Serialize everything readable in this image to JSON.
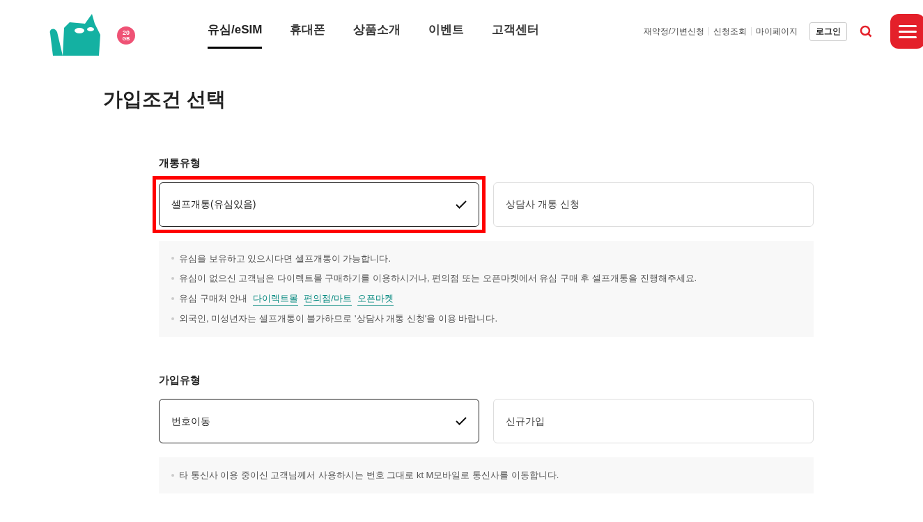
{
  "header": {
    "logo_badge": [
      "20",
      "GB"
    ],
    "nav": [
      {
        "label": "유심/eSIM",
        "selected": true
      },
      {
        "label": "휴대폰",
        "selected": false
      },
      {
        "label": "상품소개",
        "selected": false
      },
      {
        "label": "이벤트",
        "selected": false
      },
      {
        "label": "고객센터",
        "selected": false
      }
    ],
    "util_links": [
      "재약정/기변신청",
      "신청조회",
      "마이페이지"
    ],
    "login": "로그인"
  },
  "title": "가입조건 선택",
  "sections": [
    {
      "heading": "개통유형",
      "options": [
        {
          "label": "셀프개통(유심있음)",
          "selected": true,
          "highlighted": true
        },
        {
          "label": "상담사 개통 신청",
          "selected": false,
          "highlighted": false
        }
      ],
      "notes": [
        {
          "text": "유심을 보유하고 있으시다면 셀프개통이 가능합니다."
        },
        {
          "text": "유심이 없으신 고객님은 다이렉트몰 구매하기를 이용하시거나, 편의점 또는 오픈마켓에서 유심 구매 후 셀프개통을 진행해주세요."
        },
        {
          "text": "유심 구매처 안내",
          "links": [
            "다이렉트몰",
            "편의점/마트",
            "오픈마켓"
          ]
        },
        {
          "text": "외국인, 미성년자는 셀프개통이 불가하므로 '상담사 개통 신청'을 이용 바랍니다."
        }
      ]
    },
    {
      "heading": "가입유형",
      "options": [
        {
          "label": "번호이동",
          "selected": true,
          "highlighted": false
        },
        {
          "label": "신규가입",
          "selected": false,
          "highlighted": false
        }
      ],
      "notes": [
        {
          "text": "타 통신사 이용 중이신 고객님께서 사용하시는 번호 그대로 kt M모바일로 통신사를 이동합니다."
        }
      ]
    }
  ]
}
